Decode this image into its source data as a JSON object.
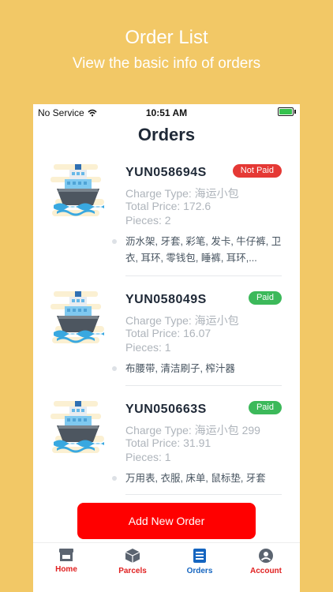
{
  "promo": {
    "title": "Order List",
    "subtitle": "View the basic info of orders"
  },
  "status_bar": {
    "carrier": "No Service",
    "time": "10:51 AM",
    "icons": [
      "wifi-icon",
      "battery-charging-icon"
    ]
  },
  "header": {
    "title": "Orders"
  },
  "orders": [
    {
      "id": "YUN058694S",
      "status": "Not Paid",
      "charge_type": "Charge Type: 海运小包",
      "total_price": "Total Price: 172.6",
      "pieces": "Pieces: 2",
      "items": "沥水架, 牙套, 彩笔, 发卡, 牛仔裤, 卫衣, 耳环, 零钱包, 睡裤, 耳环,...",
      "icon": "ship-icon"
    },
    {
      "id": "YUN058049S",
      "status": "Paid",
      "charge_type": "Charge Type: 海运小包",
      "total_price": "Total Price: 16.07",
      "pieces": "Pieces: 1",
      "items": "布腰带, 清洁刷子, 榨汁器",
      "icon": "ship-icon"
    },
    {
      "id": "YUN050663S",
      "status": "Paid",
      "charge_type": "Charge Type: 海运小包 299",
      "total_price": "Total Price: 31.91",
      "pieces": "Pieces: 1",
      "items": "万用表, 衣服, 床单, 鼠标垫, 牙套",
      "icon": "ship-icon"
    }
  ],
  "actions": {
    "add_order": "Add New Order"
  },
  "tabbar": {
    "tabs": [
      {
        "label": "Home",
        "icon": "store-icon",
        "active": false
      },
      {
        "label": "Parcels",
        "icon": "box-icon",
        "active": false
      },
      {
        "label": "Orders",
        "icon": "list-icon",
        "active": true
      },
      {
        "label": "Account",
        "icon": "user-icon",
        "active": false
      }
    ]
  },
  "colors": {
    "background": "#f2c866",
    "not_paid": "#e53935",
    "paid": "#3cb95a",
    "primary_button": "#ff0000",
    "active_tab": "#1565c0",
    "inactive_tab": "#e02020"
  }
}
